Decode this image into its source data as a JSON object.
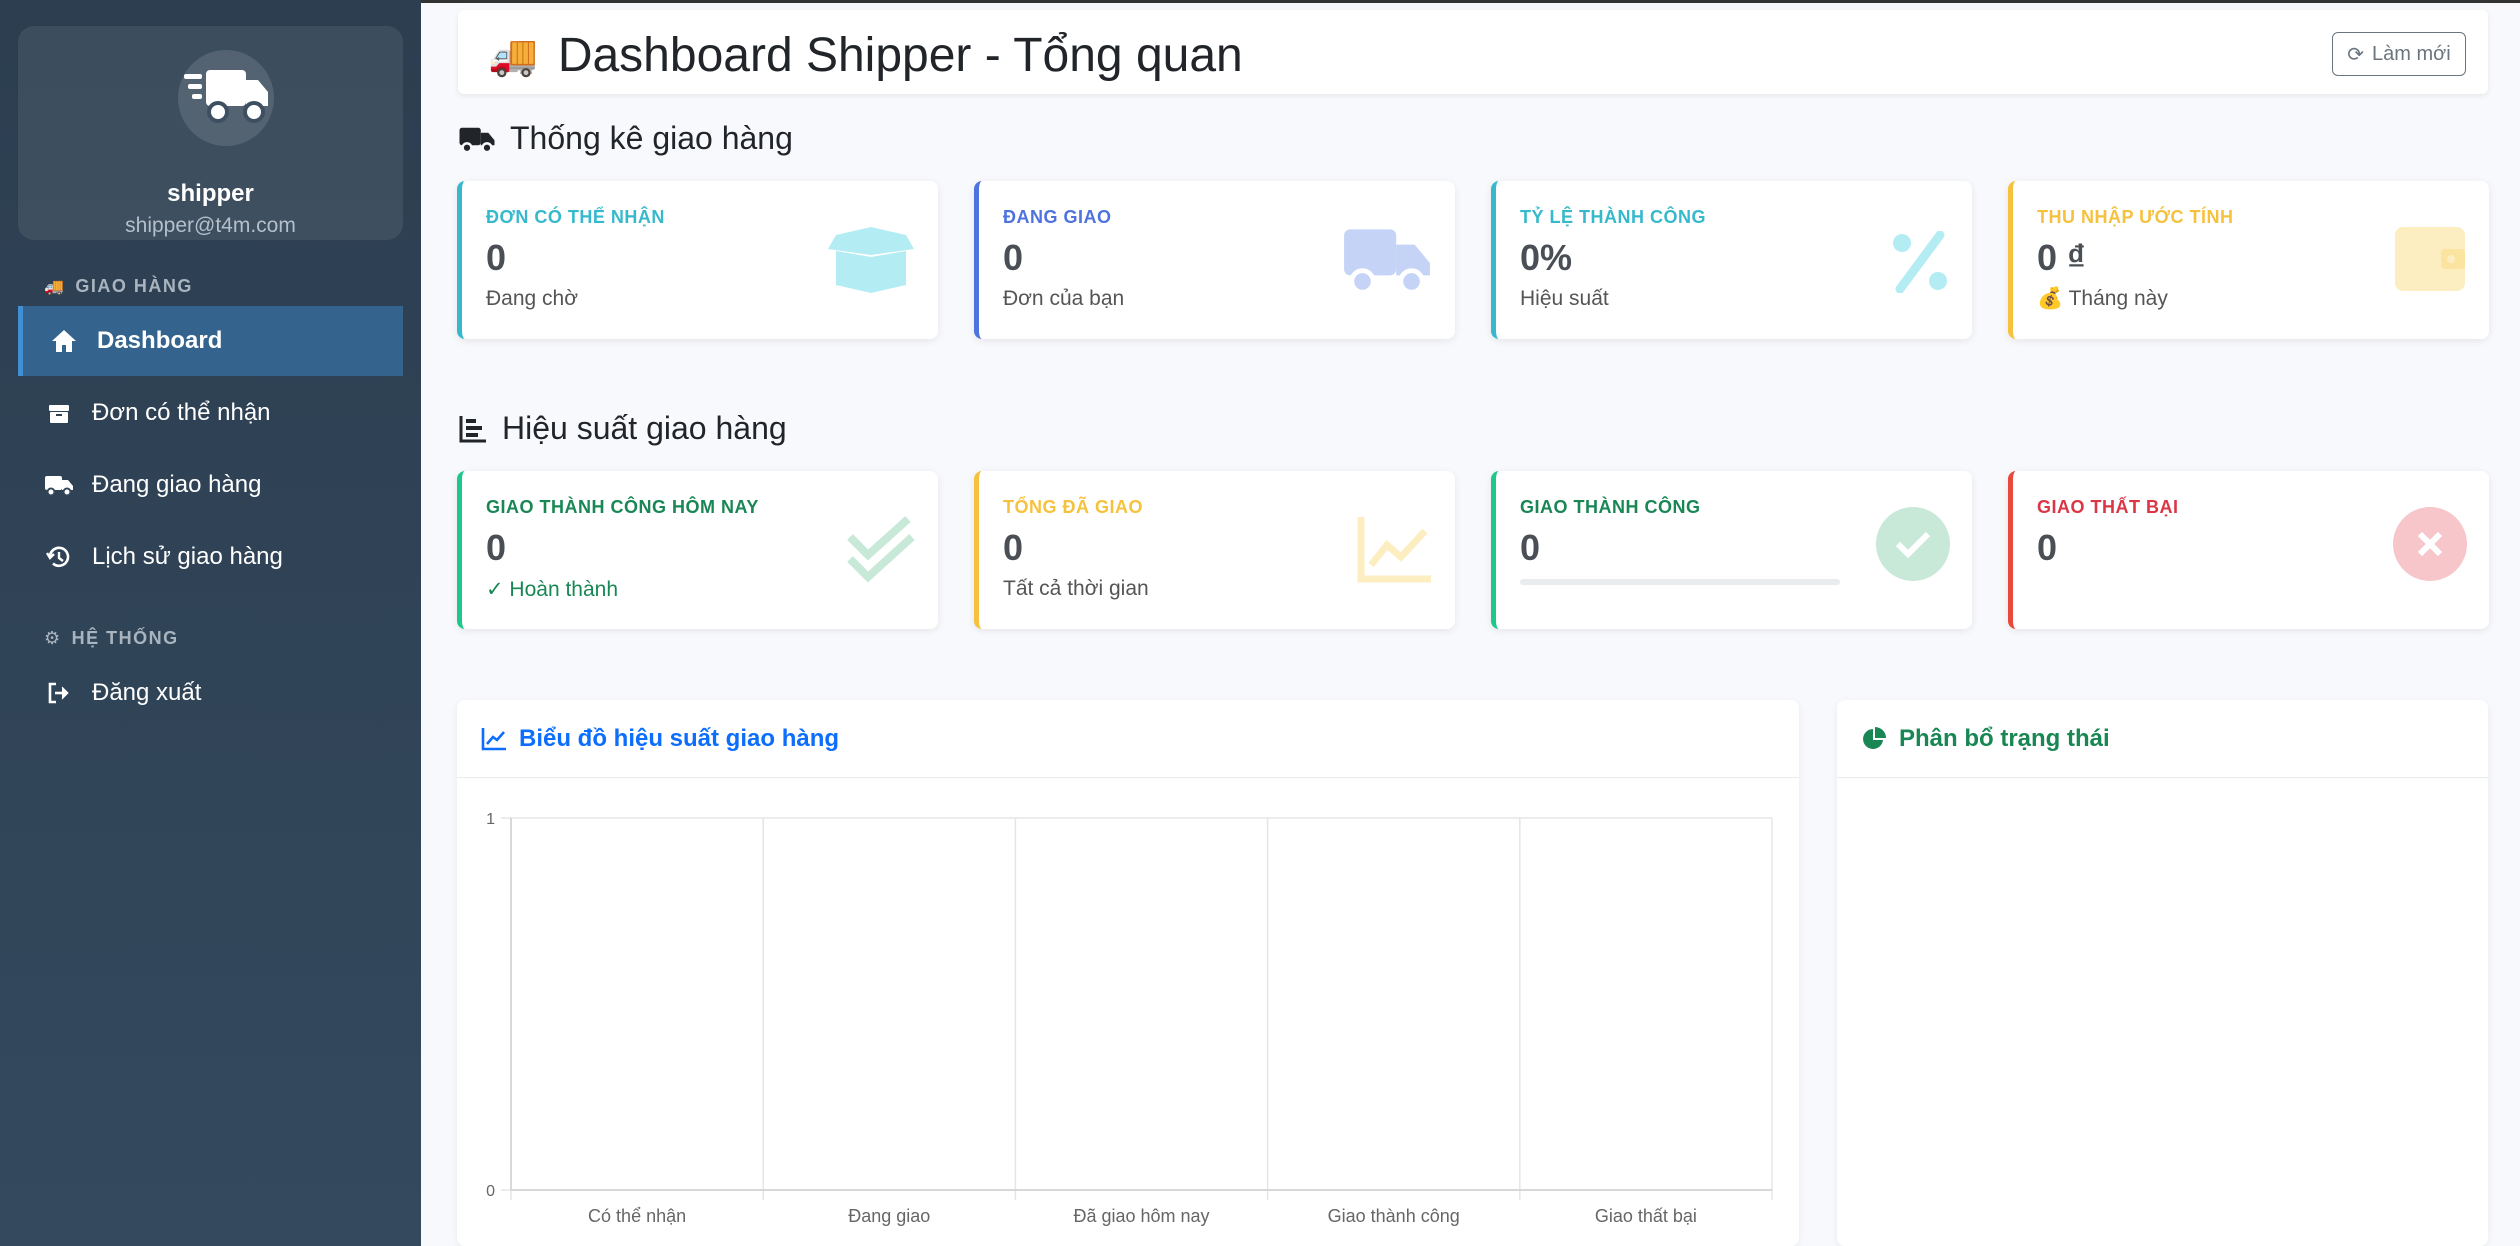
{
  "sidebar": {
    "profile": {
      "name": "shipper",
      "email": "shipper@t4m.com"
    },
    "section_delivery": "GIAO HÀNG",
    "section_system": "HỆ THỐNG",
    "items": [
      {
        "label": "Dashboard",
        "icon": "home-icon",
        "active": true
      },
      {
        "label": "Đơn có thể nhận",
        "icon": "box-icon"
      },
      {
        "label": "Đang giao hàng",
        "icon": "truck-icon"
      },
      {
        "label": "Lịch sử giao hàng",
        "icon": "history-icon"
      }
    ],
    "logout": {
      "label": "Đăng xuất",
      "icon": "logout-icon"
    }
  },
  "header": {
    "title": "Dashboard Shipper - Tổng quan",
    "refresh_label": "Làm mới"
  },
  "stats_section": {
    "title": "Thống kê giao hàng",
    "cards": [
      {
        "label": "ĐƠN CÓ THỂ NHẬN",
        "value": "0",
        "sub": "Đang chờ",
        "color": "#36b9cc",
        "icon": "box-open-icon"
      },
      {
        "label": "ĐANG GIAO",
        "value": "0",
        "sub": "Đơn của bạn",
        "color": "#4e73df",
        "icon": "truck-icon"
      },
      {
        "label": "TỶ LỆ THÀNH CÔNG",
        "value": "0%",
        "sub": "Hiệu suất",
        "color": "#36b9cc",
        "icon": "percent-icon"
      },
      {
        "label": "THU NHẬP ƯỚC TÍNH",
        "value": "0 ₫",
        "sub": "💰 Tháng này",
        "color": "#f6c23e",
        "icon": "wallet-icon"
      }
    ]
  },
  "performance_section": {
    "title": "Hiệu suất giao hàng",
    "cards": [
      {
        "label": "GIAO THÀNH CÔNG HÔM NAY",
        "value": "0",
        "sub": "✓ Hoàn thành",
        "color": "#1cc88a",
        "icon": "double-check-icon"
      },
      {
        "label": "TỔNG ĐÃ GIAO",
        "value": "0",
        "sub": "Tất cả thời gian",
        "color": "#f6c23e",
        "icon": "chart-line-icon"
      },
      {
        "label": "GIAO THÀNH CÔNG",
        "value": "0",
        "progress": 0,
        "color": "#1cc88a",
        "icon": "check-circle-icon"
      },
      {
        "label": "GIAO THẤT BẠI",
        "value": "0",
        "color": "#e74a3b",
        "icon": "x-circle-icon"
      }
    ]
  },
  "chart_panel": {
    "title": "Biểu đồ hiệu suất giao hàng"
  },
  "status_panel": {
    "title": "Phân bổ trạng thái"
  },
  "chart_data": {
    "type": "bar",
    "categories": [
      "Có thể nhận",
      "Đang giao",
      "Đã giao hôm nay",
      "Giao thành công",
      "Giao thất bại"
    ],
    "values": [
      0,
      0,
      0,
      0,
      0
    ],
    "ylim": [
      0,
      1
    ],
    "yticks": [
      "0",
      "1"
    ],
    "grid": true
  }
}
